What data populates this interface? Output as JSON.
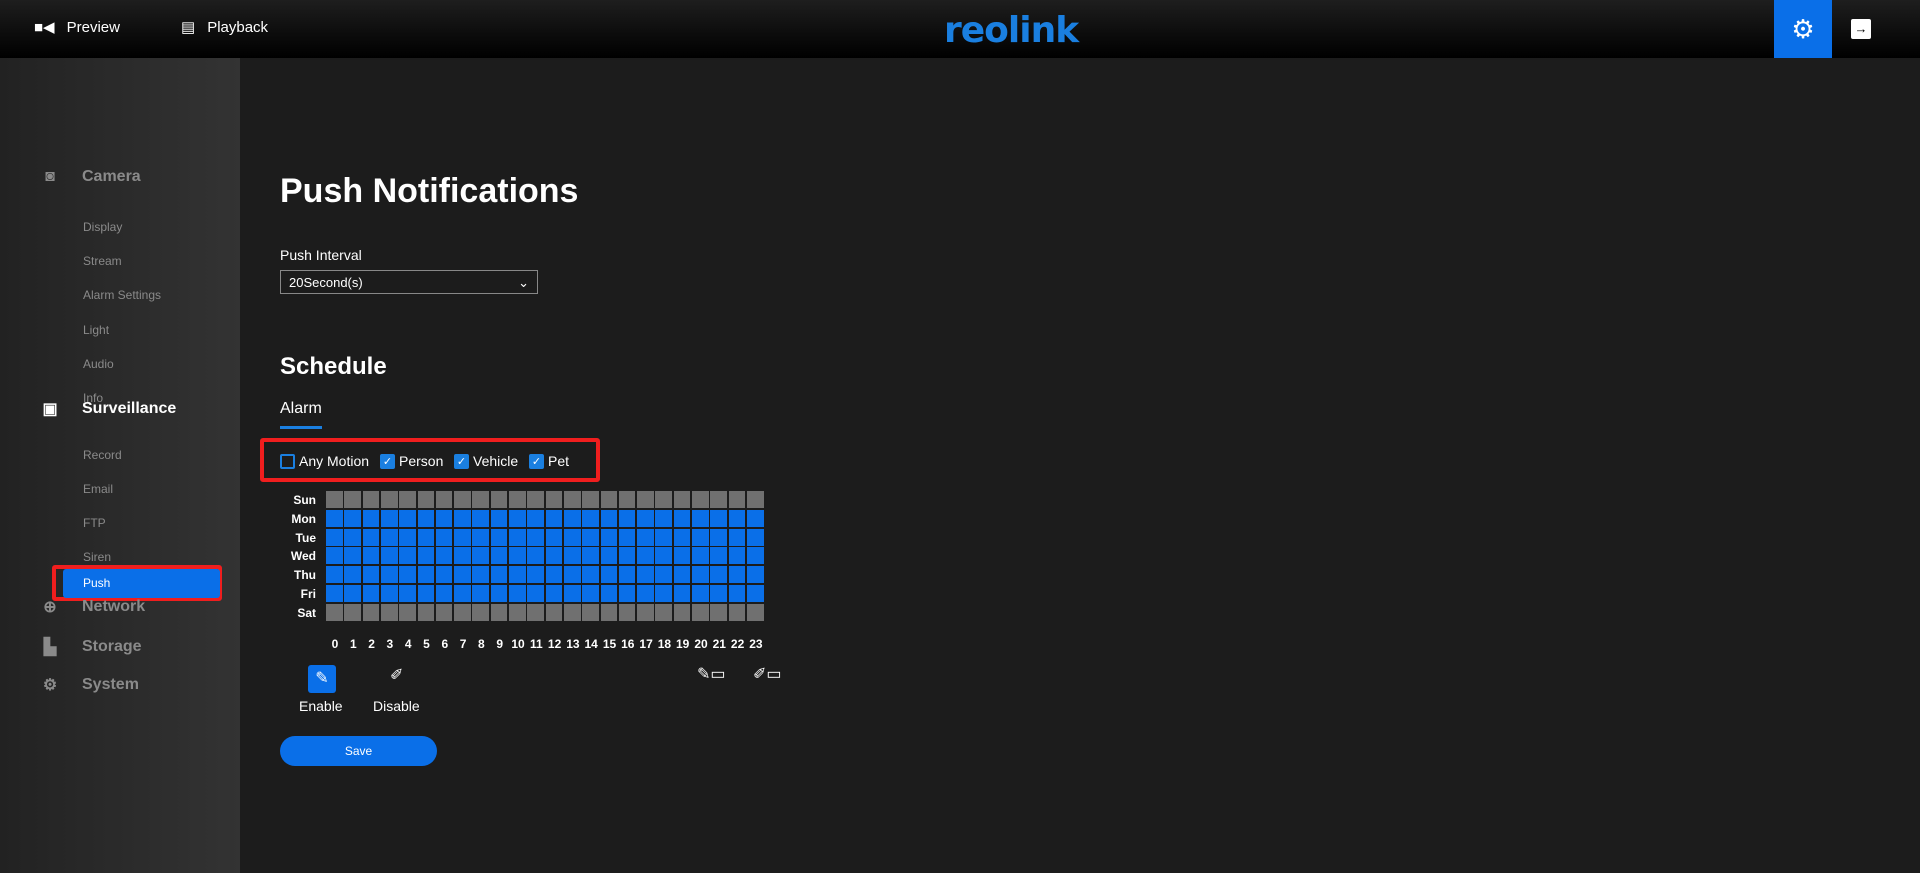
{
  "header": {
    "nav": [
      {
        "label": "Preview",
        "icon": "video-camera-icon"
      },
      {
        "label": "Playback",
        "icon": "film-icon"
      }
    ],
    "logo": "reolink",
    "settings_icon": "gear-icon",
    "logout_icon": "logout-icon"
  },
  "sidebar": {
    "sections": [
      {
        "label": "Camera",
        "icon": "camera-icon",
        "items": [
          "Display",
          "Stream",
          "Alarm Settings",
          "Light",
          "Audio",
          "Info"
        ]
      },
      {
        "label": "Surveillance",
        "icon": "monitor-icon",
        "items": [
          "Record",
          "Email",
          "FTP",
          "Siren",
          "Push"
        ]
      },
      {
        "label": "Network",
        "icon": "globe-icon",
        "items": []
      },
      {
        "label": "Storage",
        "icon": "sd-card-icon",
        "items": []
      },
      {
        "label": "System",
        "icon": "gear-icon",
        "items": []
      }
    ],
    "active": "Push"
  },
  "main": {
    "title": "Push Notifications",
    "push_interval_label": "Push Interval",
    "push_interval_value": "20Second(s)",
    "schedule_title": "Schedule",
    "tab": "Alarm",
    "filters": [
      {
        "label": "Any Motion",
        "checked": false
      },
      {
        "label": "Person",
        "checked": true
      },
      {
        "label": "Vehicle",
        "checked": true
      },
      {
        "label": "Pet",
        "checked": true
      }
    ],
    "days": [
      "Sun",
      "Mon",
      "Tue",
      "Wed",
      "Thu",
      "Fri",
      "Sat"
    ],
    "hours": [
      "0",
      "1",
      "2",
      "3",
      "4",
      "5",
      "6",
      "7",
      "8",
      "9",
      "10",
      "11",
      "12",
      "13",
      "14",
      "15",
      "16",
      "17",
      "18",
      "19",
      "20",
      "21",
      "22",
      "23"
    ],
    "day_enabled": [
      false,
      true,
      true,
      true,
      true,
      true,
      false
    ],
    "enable_label": "Enable",
    "disable_label": "Disable",
    "save_label": "Save",
    "colors": {
      "enabled": "#0a6fe8",
      "disabled": "#707070"
    }
  }
}
